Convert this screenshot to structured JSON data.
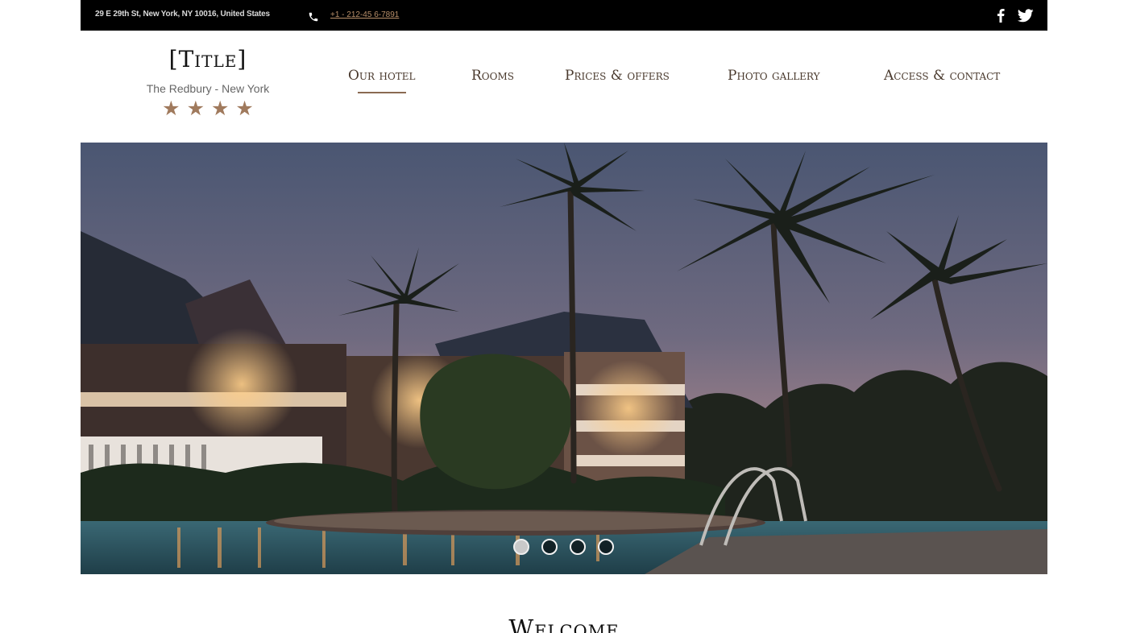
{
  "topbar": {
    "address": "29 E 29th St, New York, NY 10016, United States",
    "phone": "+1 - 212-45 6-7891",
    "phone_icon": "phone-icon",
    "social_icons": [
      "facebook-icon",
      "twitter-icon"
    ]
  },
  "logo": {
    "title": "[Title]",
    "subtitle": "The Redbury - New York",
    "stars": "★★★★"
  },
  "nav": {
    "items": [
      {
        "label": "Our hotel",
        "active": true
      },
      {
        "label": "Rooms",
        "active": false
      },
      {
        "label": "Prices & offers",
        "active": false
      },
      {
        "label": "Photo gallery",
        "active": false
      },
      {
        "label": "Access & contact",
        "active": false
      }
    ]
  },
  "slider": {
    "slide_count": 4,
    "current": 1
  },
  "welcome": {
    "heading": "Welcome"
  },
  "colors": {
    "accent": "#a07a5d",
    "topbar_bg": "#000000",
    "link": "#b9906a"
  }
}
